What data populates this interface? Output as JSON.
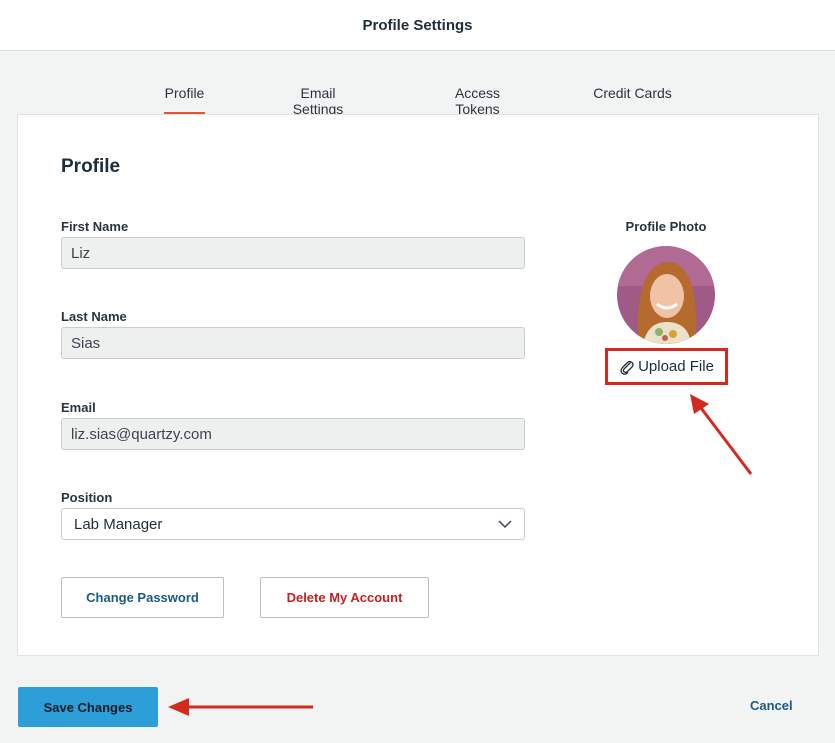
{
  "header": {
    "title": "Profile Settings"
  },
  "tabs": [
    {
      "label": "Profile",
      "active": true
    },
    {
      "label": "Email Settings",
      "active": false
    },
    {
      "label": "Access Tokens",
      "active": false
    },
    {
      "label": "Credit Cards",
      "active": false
    }
  ],
  "profile": {
    "section_title": "Profile",
    "first_name": {
      "label": "First Name",
      "value": "Liz"
    },
    "last_name": {
      "label": "Last Name",
      "value": "Sias"
    },
    "email": {
      "label": "Email",
      "value": "liz.sias@quartzy.com"
    },
    "position": {
      "label": "Position",
      "selected": "Lab Manager"
    },
    "change_password_label": "Change Password",
    "delete_account_label": "Delete My Account"
  },
  "photo": {
    "label": "Profile Photo",
    "upload_label": "Upload File",
    "upload_icon": "paperclip-icon"
  },
  "footer": {
    "save_label": "Save Changes",
    "cancel_label": "Cancel"
  },
  "colors": {
    "accent_tab": "#e8532f",
    "primary_button": "#2d9fd8",
    "link": "#1b5b82",
    "danger": "#c8201e",
    "annotation": "#d42a1d"
  }
}
